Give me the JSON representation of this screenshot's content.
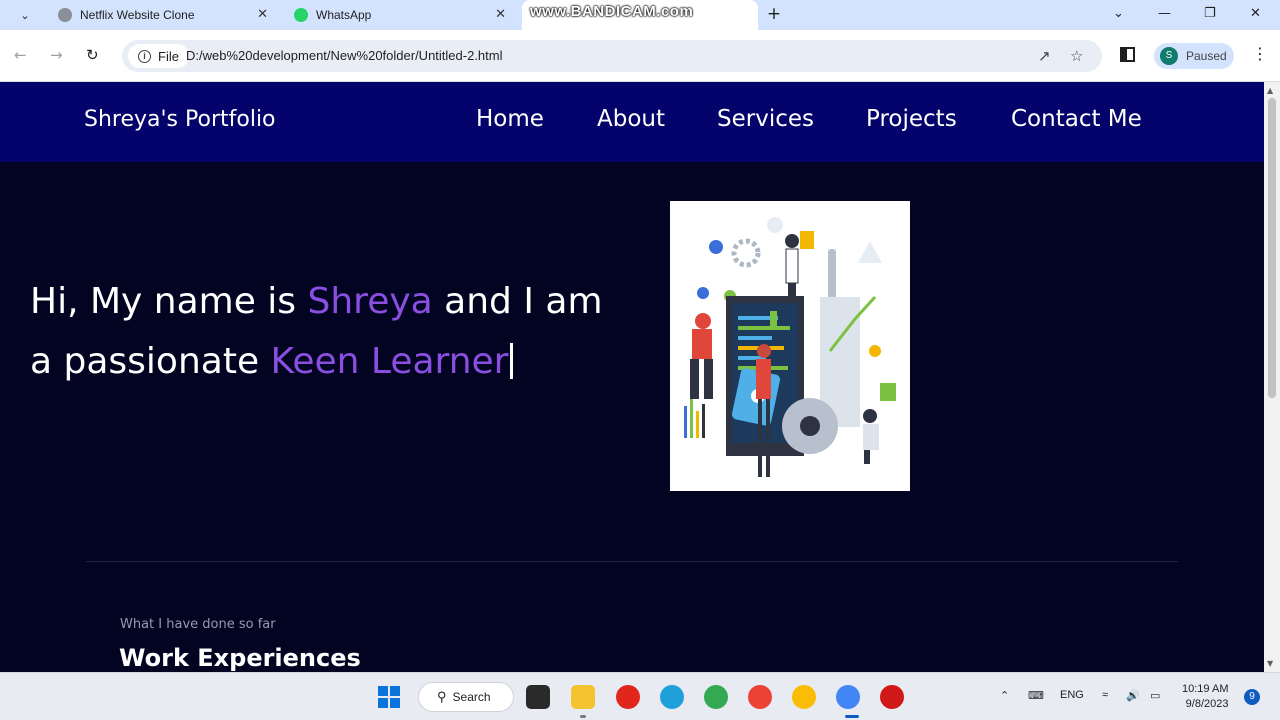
{
  "browser": {
    "tabs": [
      {
        "title": "Netflix Website Clone",
        "favicon": "globe-icon"
      },
      {
        "title": "WhatsApp",
        "favicon": "whatsapp-icon"
      }
    ],
    "active_tab_overlay": "www.BANDICAM.com",
    "address": {
      "scheme_label": "File",
      "url": "D:/web%20development/New%20folder/Untitled-2.html"
    },
    "profile": {
      "initial": "S",
      "status": "Paused"
    }
  },
  "site": {
    "brand": "Shreya's Portfolio",
    "nav": [
      "Home",
      "About",
      "Services",
      "Projects",
      "Contact Me"
    ],
    "hero": {
      "intro_1": "Hi, My name is ",
      "name": "Shreya",
      "intro_2": " and I am a passionate ",
      "role": "Keen Learner"
    },
    "experience": {
      "subtitle": "What I have done so far",
      "title": "Work Experiences"
    }
  },
  "taskbar": {
    "search_label": "Search",
    "language": "ENG",
    "time": "10:19 AM",
    "date": "9/8/2023",
    "notification_count": "9"
  },
  "colors": {
    "page_bg": "#030322",
    "nav_bg": "#03036b",
    "accent": "#8a4fe0"
  }
}
